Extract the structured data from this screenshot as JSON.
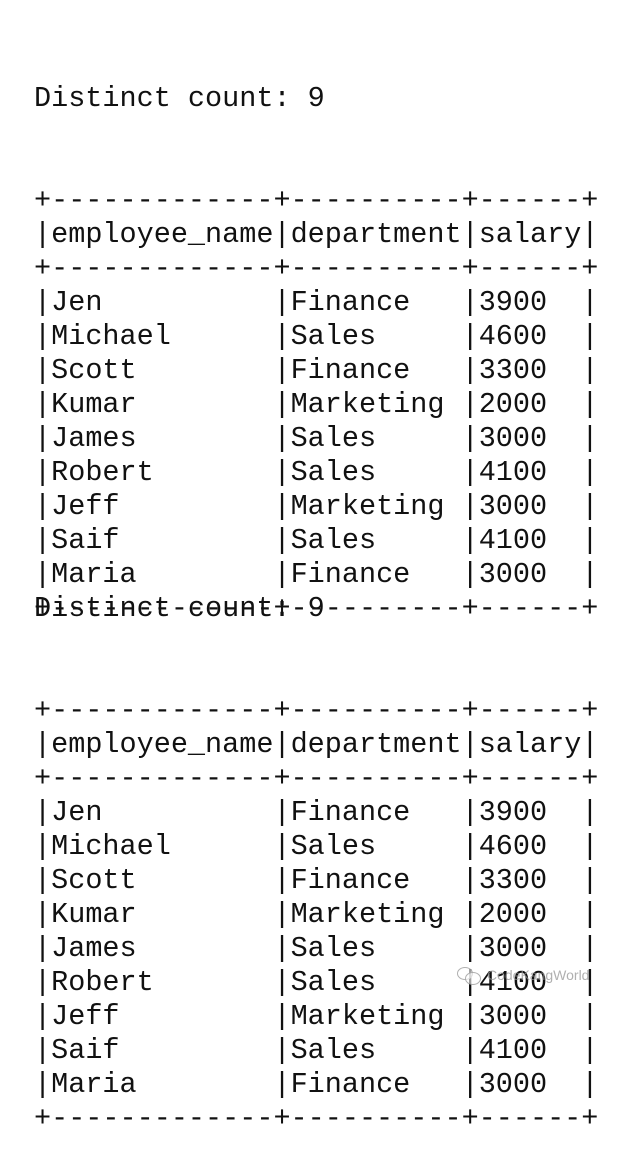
{
  "outputs": [
    {
      "distinct_label": "Distinct count: 9",
      "columns": [
        "employee_name",
        "department",
        "salary"
      ],
      "rows": [
        [
          "Jen",
          "Finance",
          "3900"
        ],
        [
          "Michael",
          "Sales",
          "4600"
        ],
        [
          "Scott",
          "Finance",
          "3300"
        ],
        [
          "Kumar",
          "Marketing",
          "2000"
        ],
        [
          "James",
          "Sales",
          "3000"
        ],
        [
          "Robert",
          "Sales",
          "4100"
        ],
        [
          "Jeff",
          "Marketing",
          "3000"
        ],
        [
          "Saif",
          "Sales",
          "4100"
        ],
        [
          "Maria",
          "Finance",
          "3000"
        ]
      ]
    },
    {
      "distinct_label": "Distinct count: 9",
      "columns": [
        "employee_name",
        "department",
        "salary"
      ],
      "rows": [
        [
          "Jen",
          "Finance",
          "3900"
        ],
        [
          "Michael",
          "Sales",
          "4600"
        ],
        [
          "Scott",
          "Finance",
          "3300"
        ],
        [
          "Kumar",
          "Marketing",
          "2000"
        ],
        [
          "James",
          "Sales",
          "3000"
        ],
        [
          "Robert",
          "Sales",
          "4100"
        ],
        [
          "Jeff",
          "Marketing",
          "3000"
        ],
        [
          "Saif",
          "Sales",
          "4100"
        ],
        [
          "Maria",
          "Finance",
          "3000"
        ]
      ]
    }
  ],
  "watermark": {
    "text": "CodeKangWorld",
    "icon": "wechat-icon"
  }
}
